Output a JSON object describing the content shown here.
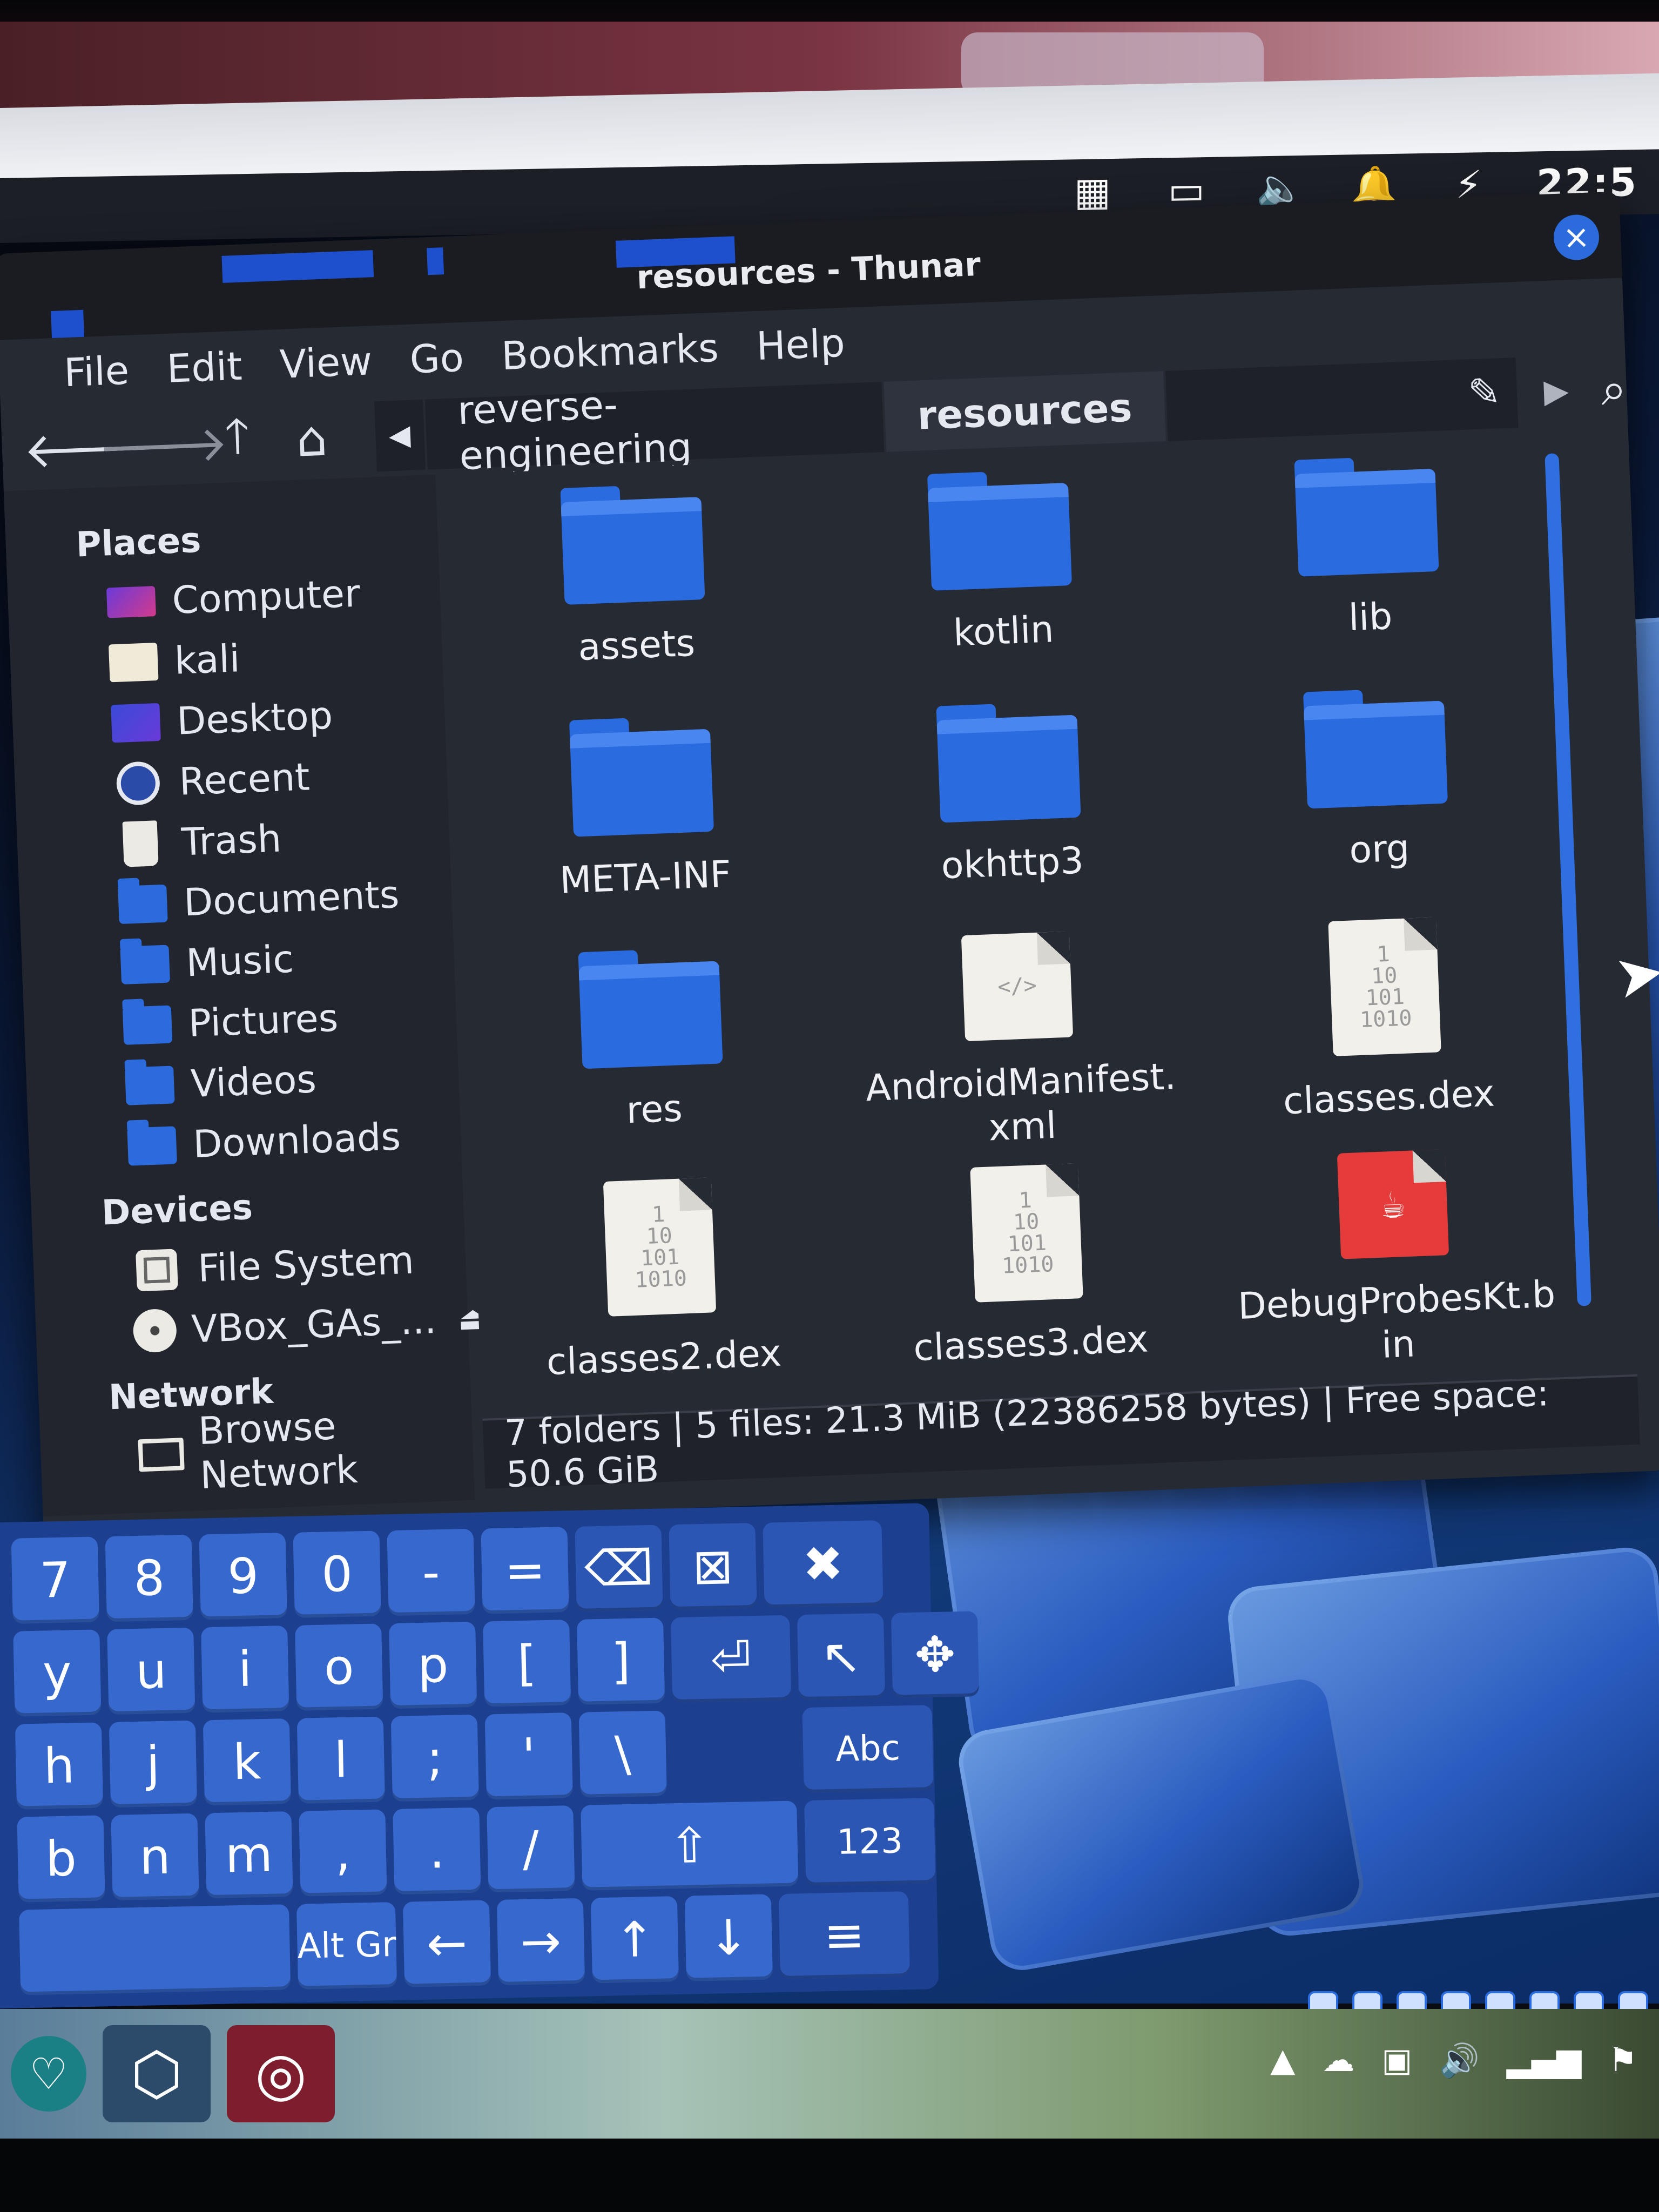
{
  "window": {
    "title": "resources - Thunar"
  },
  "vm_panel": {
    "clock": "22:5"
  },
  "menu": [
    "File",
    "Edit",
    "View",
    "Go",
    "Bookmarks",
    "Help"
  ],
  "toolbar": {
    "breadcrumbs": [
      "reverse-engineering",
      "resources"
    ]
  },
  "sidebar": {
    "places_heading": "Places",
    "places": [
      {
        "label": "Computer",
        "icon": "computer-icon"
      },
      {
        "label": "kali",
        "icon": "home-folder-icon"
      },
      {
        "label": "Desktop",
        "icon": "desktop-icon"
      },
      {
        "label": "Recent",
        "icon": "recent-icon"
      },
      {
        "label": "Trash",
        "icon": "trash-icon"
      },
      {
        "label": "Documents",
        "icon": "documents-folder-icon"
      },
      {
        "label": "Music",
        "icon": "music-folder-icon"
      },
      {
        "label": "Pictures",
        "icon": "pictures-folder-icon"
      },
      {
        "label": "Videos",
        "icon": "videos-folder-icon"
      },
      {
        "label": "Downloads",
        "icon": "downloads-folder-icon"
      }
    ],
    "devices_heading": "Devices",
    "devices": [
      {
        "label": "File System",
        "icon": "drive-icon"
      },
      {
        "label": "VBox_GAs_...",
        "icon": "disc-icon",
        "eject": true
      }
    ],
    "network_heading": "Network",
    "network": [
      {
        "label": "Browse Network",
        "icon": "network-icon"
      }
    ]
  },
  "files": [
    {
      "name": "assets",
      "type": "folder"
    },
    {
      "name": "kotlin",
      "type": "folder"
    },
    {
      "name": "lib",
      "type": "folder"
    },
    {
      "name": "META-INF",
      "type": "folder"
    },
    {
      "name": "okhttp3",
      "type": "folder"
    },
    {
      "name": "org",
      "type": "folder"
    },
    {
      "name": "res",
      "type": "folder"
    },
    {
      "name": "AndroidManifest.xml",
      "type": "xml"
    },
    {
      "name": "classes.dex",
      "type": "binary"
    },
    {
      "name": "classes2.dex",
      "type": "binary"
    },
    {
      "name": "classes3.dex",
      "type": "binary"
    },
    {
      "name": "DebugProbesKt.bin",
      "type": "java-binary"
    }
  ],
  "status": {
    "text": "7 folders | 5 files: 21.3 MiB (22386258 bytes) | Free space: 50.6 GiB"
  },
  "keyboard": {
    "rows": [
      [
        "7",
        "8",
        "9",
        "0",
        "-",
        "=",
        "⌫",
        "⊠",
        "✖"
      ],
      [
        "y",
        "u",
        "i",
        "o",
        "p",
        "[",
        "]",
        "⏎",
        "↖",
        "✥"
      ],
      [
        "h",
        "j",
        "k",
        "l",
        ";",
        "'",
        "\\",
        "Abc"
      ],
      [
        "b",
        "n",
        "m",
        ",",
        ".",
        "/",
        "⇧",
        "123"
      ],
      [
        "",
        "Alt Gr",
        "←",
        "→",
        "↑",
        "↓",
        "≡"
      ]
    ]
  },
  "colors": {
    "accent": "#2b6be0",
    "window_bg": "#262a33",
    "sidebar_bg": "#22252d",
    "keyboard_bg": "#1d3f8f"
  }
}
